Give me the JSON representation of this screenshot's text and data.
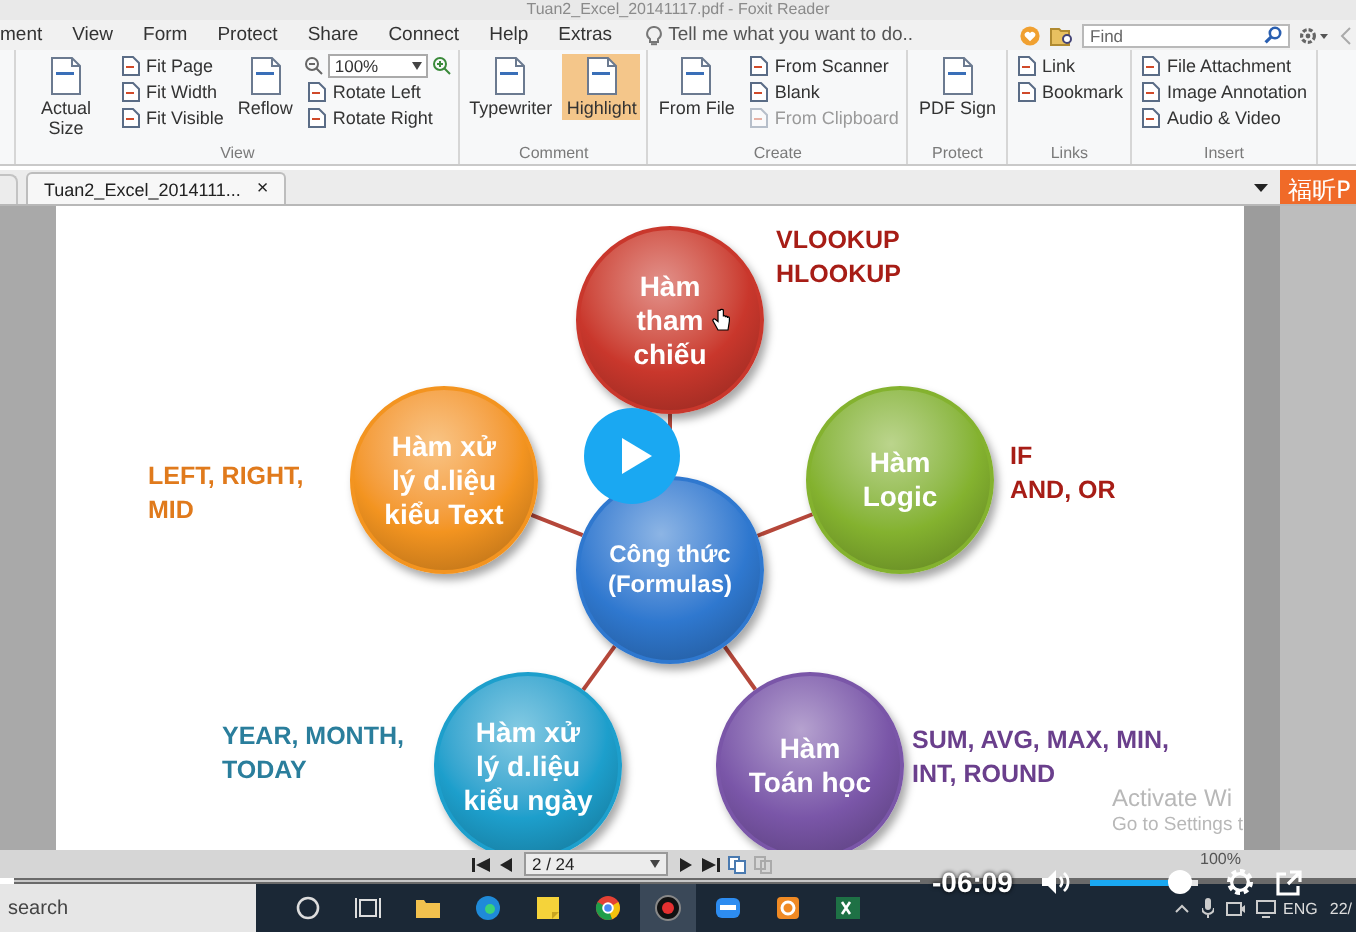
{
  "window": {
    "title": "Tuan2_Excel_20141117.pdf - Foxit Reader"
  },
  "menu": [
    "ment",
    "View",
    "Form",
    "Protect",
    "Share",
    "Connect",
    "Help",
    "Extras"
  ],
  "tell_me": {
    "placeholder": "Tell me what you want to do.."
  },
  "find": {
    "placeholder": "Find"
  },
  "ribbon": {
    "groups": [
      {
        "label": "View",
        "columns": [
          [
            {
              "kind": "large",
              "label": "Actual Size",
              "selected": false,
              "disabled": false
            }
          ],
          [
            {
              "kind": "small",
              "label": "Fit Page",
              "selected": false,
              "disabled": false
            },
            {
              "kind": "small",
              "label": "Fit Width",
              "selected": false,
              "disabled": false
            },
            {
              "kind": "small",
              "label": "Fit Visible",
              "selected": false,
              "disabled": false
            }
          ],
          [
            {
              "kind": "large",
              "label": "Reflow",
              "selected": false,
              "disabled": false
            }
          ],
          [
            {
              "kind": "combo",
              "label": "100%",
              "selected": false,
              "disabled": false
            },
            {
              "kind": "small",
              "label": "Rotate Left",
              "selected": false,
              "disabled": false
            },
            {
              "kind": "small",
              "label": "Rotate Right",
              "selected": false,
              "disabled": false
            }
          ]
        ]
      },
      {
        "label": "Comment",
        "columns": [
          [
            {
              "kind": "large",
              "label": "Typewriter",
              "selected": false,
              "disabled": false
            }
          ],
          [
            {
              "kind": "large",
              "label": "Highlight",
              "selected": true,
              "disabled": false
            }
          ]
        ]
      },
      {
        "label": "Create",
        "columns": [
          [
            {
              "kind": "large",
              "label": "From File",
              "selected": false,
              "disabled": false
            }
          ],
          [
            {
              "kind": "small",
              "label": "From Scanner",
              "selected": false,
              "disabled": false
            },
            {
              "kind": "small",
              "label": "Blank",
              "selected": false,
              "disabled": false
            },
            {
              "kind": "small",
              "label": "From Clipboard",
              "selected": false,
              "disabled": true
            }
          ]
        ]
      },
      {
        "label": "Protect",
        "columns": [
          [
            {
              "kind": "large",
              "label": "PDF Sign",
              "selected": false,
              "disabled": false
            }
          ]
        ]
      },
      {
        "label": "Links",
        "columns": [
          [
            {
              "kind": "small",
              "label": "Link",
              "selected": false,
              "disabled": false
            },
            {
              "kind": "small",
              "label": "Bookmark",
              "selected": false,
              "disabled": false
            }
          ]
        ]
      },
      {
        "label": "Insert",
        "columns": [
          [
            {
              "kind": "small",
              "label": "File Attachment",
              "selected": false,
              "disabled": false
            },
            {
              "kind": "small",
              "label": "Image Annotation",
              "selected": false,
              "disabled": false
            },
            {
              "kind": "small",
              "label": "Audio & Video",
              "selected": false,
              "disabled": false
            }
          ]
        ]
      }
    ]
  },
  "tabs": [
    {
      "label": "Tuan2_Excel_2014111...",
      "close": "×",
      "selected": true
    }
  ],
  "promo": "福昕P",
  "diagram": {
    "nodes": [
      {
        "kind": "branch",
        "lines": [
          "Hàm",
          "tham",
          "chiếu"
        ],
        "color": "#c9372c"
      },
      {
        "kind": "branch",
        "lines": [
          "Hàm xử",
          "lý d.liệu",
          "kiểu Text"
        ],
        "color": "#f39420"
      },
      {
        "kind": "branch",
        "lines": [
          "Hàm",
          "Logic"
        ],
        "color": "#84b22f"
      },
      {
        "kind": "center",
        "lines": [
          "Công thức",
          "(Formulas)"
        ],
        "color": "#2f78cf"
      },
      {
        "kind": "branch",
        "lines": [
          "Hàm xử",
          "lý d.liệu",
          "kiểu ngày"
        ],
        "color": "#1d9fcc"
      },
      {
        "kind": "branch",
        "lines": [
          "Hàm",
          "Toán học"
        ],
        "color": "#7a56a8"
      }
    ],
    "notes": [
      {
        "lines": [
          "VLOOKUP",
          "HLOOKUP"
        ],
        "color": "#a71d16"
      },
      {
        "lines": [
          "LEFT, RIGHT,",
          "MID"
        ],
        "color": "#e07a1c"
      },
      {
        "lines": [
          "IF",
          "AND, OR"
        ],
        "color": "#a71d16"
      },
      {
        "lines": [
          "YEAR, MONTH,",
          "TODAY"
        ],
        "color": "#2a7e9c"
      },
      {
        "lines": [
          "SUM, AVG, MAX, MIN,",
          "INT, ROUND"
        ],
        "color": "#6a3f8c"
      }
    ]
  },
  "activation": [
    "Activate Wi",
    "Go to Settings t"
  ],
  "nav": {
    "page": "2 / 24",
    "zoom": "100%"
  },
  "video": {
    "time": "-06:09",
    "volume": {
      "level": 0.82
    },
    "progress": {
      "level": 0.015
    }
  },
  "taskbar": {
    "search": "search",
    "apps": [
      {
        "selected": false
      },
      {
        "selected": false
      },
      {
        "selected": false
      },
      {
        "selected": false
      },
      {
        "selected": false
      },
      {
        "selected": false
      },
      {
        "selected": true
      },
      {
        "selected": false
      },
      {
        "selected": false
      },
      {
        "selected": false
      }
    ],
    "language": "ENG",
    "clock": "22/"
  }
}
